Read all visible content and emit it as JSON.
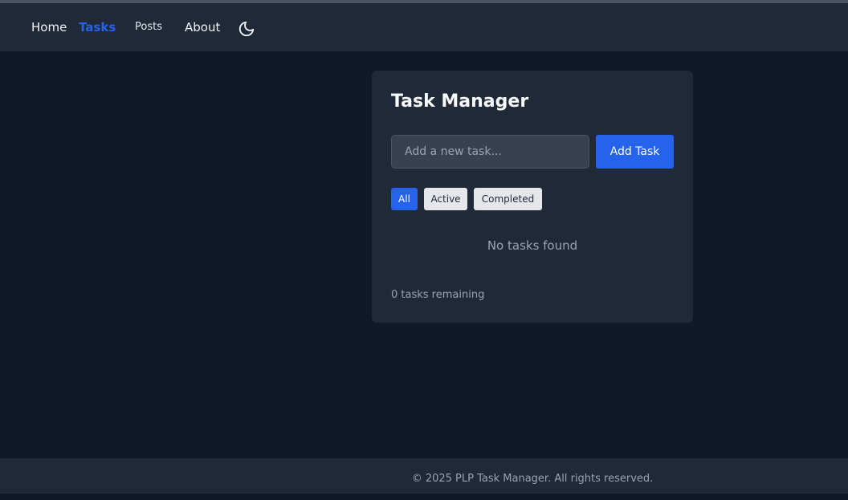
{
  "nav": {
    "items": [
      {
        "label": "Home",
        "active": false
      },
      {
        "label": "Tasks",
        "active": true
      },
      {
        "label": "Posts",
        "active": false
      },
      {
        "label": "About",
        "active": false
      }
    ],
    "theme_toggle_icon": "moon-icon"
  },
  "task_manager": {
    "title": "Task Manager",
    "input": {
      "placeholder": "Add a new task...",
      "value": ""
    },
    "add_button_label": "Add Task",
    "filters": [
      {
        "label": "All",
        "selected": true
      },
      {
        "label": "Active",
        "selected": false
      },
      {
        "label": "Completed",
        "selected": false
      }
    ],
    "empty_message": "No tasks found",
    "remaining_text": "0 tasks remaining"
  },
  "footer": {
    "text": "© 2025 PLP Task Manager. All rights reserved."
  },
  "colors": {
    "page_bg": "#111827",
    "surface": "#1f2937",
    "accent": "#2563eb"
  }
}
